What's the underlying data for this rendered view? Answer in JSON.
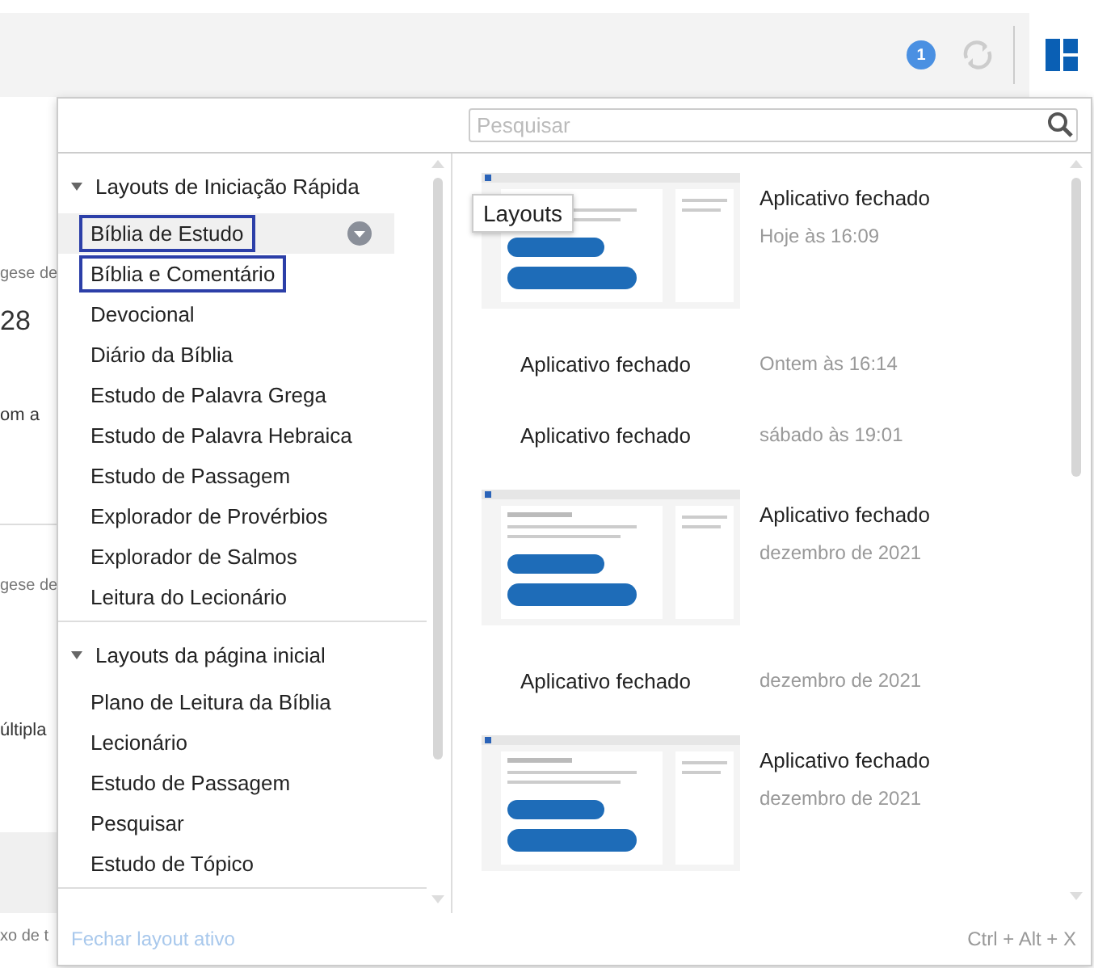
{
  "toolbar": {
    "notification_count": "1"
  },
  "background_texts": [
    {
      "text": "gese de",
      "kind": "small"
    },
    {
      "text": "28",
      "kind": "large"
    },
    {
      "text": "om a",
      "kind": "body"
    },
    {
      "text": "gese de",
      "kind": "small"
    },
    {
      "text": "últipla",
      "kind": "body"
    },
    {
      "text": "xo de t",
      "kind": "small"
    }
  ],
  "search": {
    "placeholder": "Pesquisar"
  },
  "layout_sections": [
    {
      "title": "Layouts de Iniciação Rápida",
      "expanded": true,
      "items": [
        {
          "label": "Bíblia de Estudo",
          "hovered": true,
          "outlined": true
        },
        {
          "label": "Bíblia e Comentário",
          "hovered": false,
          "outlined": true
        },
        {
          "label": "Devocional",
          "hovered": false,
          "outlined": false
        },
        {
          "label": "Diário da Bíblia",
          "hovered": false,
          "outlined": false
        },
        {
          "label": "Estudo de Palavra Grega",
          "hovered": false,
          "outlined": false
        },
        {
          "label": "Estudo de Palavra Hebraica",
          "hovered": false,
          "outlined": false
        },
        {
          "label": "Estudo de Passagem",
          "hovered": false,
          "outlined": false
        },
        {
          "label": "Explorador de Provérbios",
          "hovered": false,
          "outlined": false
        },
        {
          "label": "Explorador de Salmos",
          "hovered": false,
          "outlined": false
        },
        {
          "label": "Leitura do Lecionário",
          "hovered": false,
          "outlined": false
        }
      ]
    },
    {
      "title": "Layouts da página inicial",
      "expanded": true,
      "items": [
        {
          "label": "Plano de Leitura da Bíblia",
          "hovered": false,
          "outlined": false
        },
        {
          "label": "Lecionário",
          "hovered": false,
          "outlined": false
        },
        {
          "label": "Estudo de Passagem",
          "hovered": false,
          "outlined": false
        },
        {
          "label": "Pesquisar",
          "hovered": false,
          "outlined": false
        },
        {
          "label": "Estudo de Tópico",
          "hovered": false,
          "outlined": false
        }
      ]
    }
  ],
  "history": [
    {
      "kind": "thumbnail",
      "title": "Aplicativo fechado",
      "time": "Hoje às 16:09"
    },
    {
      "kind": "plain",
      "title": "Aplicativo fechado",
      "time": "Ontem às 16:14"
    },
    {
      "kind": "plain",
      "title": "Aplicativo fechado",
      "time": "sábado às 19:01"
    },
    {
      "kind": "thumbnail",
      "title": "Aplicativo fechado",
      "time": "dezembro de 2021"
    },
    {
      "kind": "plain",
      "title": "Aplicativo fechado",
      "time": "dezembro de 2021"
    },
    {
      "kind": "thumbnail",
      "title": "Aplicativo fechado",
      "time": "dezembro de 2021"
    }
  ],
  "tooltip": "Layouts",
  "footer": {
    "action": "Fechar layout ativo",
    "shortcut": "Ctrl + Alt + X"
  }
}
